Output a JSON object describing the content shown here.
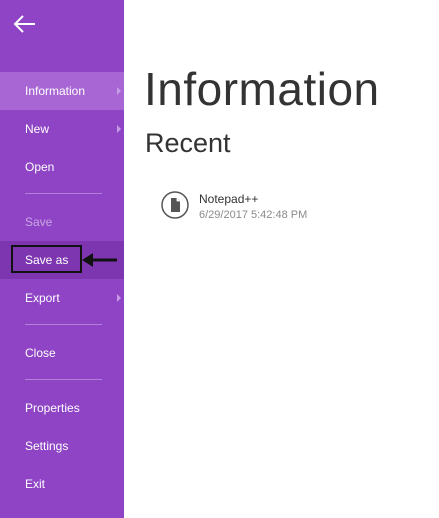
{
  "sidebar": {
    "back_icon": "back-arrow-icon",
    "items": [
      {
        "label": "Information",
        "state": "selected",
        "has_submenu": true
      },
      {
        "label": "New",
        "state": "normal",
        "has_submenu": true
      },
      {
        "label": "Open",
        "state": "normal",
        "has_submenu": false
      },
      {
        "label": "Save",
        "state": "disabled",
        "has_submenu": false
      },
      {
        "label": "Save as",
        "state": "hovered",
        "has_submenu": false
      },
      {
        "label": "Export",
        "state": "normal",
        "has_submenu": true
      },
      {
        "label": "Close",
        "state": "normal",
        "has_submenu": false
      },
      {
        "label": "Properties",
        "state": "normal",
        "has_submenu": false
      },
      {
        "label": "Settings",
        "state": "normal",
        "has_submenu": false
      },
      {
        "label": "Exit",
        "state": "normal",
        "has_submenu": false
      }
    ]
  },
  "main": {
    "title": "Information",
    "recent": {
      "heading": "Recent",
      "items": [
        {
          "name": "Notepad++",
          "date": "6/29/2017 5:42:48 PM",
          "icon": "document-icon"
        }
      ]
    }
  },
  "annotation": {
    "highlight_target": "Save as",
    "arrow_icon": "left-arrow-icon"
  },
  "colors": {
    "sidebar_bg": "#8e44c4",
    "selected_bg": "#a766d3",
    "hover_bg": "#7d36b0",
    "disabled_text": "#c9a6e3",
    "main_bg": "#ffffff",
    "title_text": "#333333",
    "secondary_text": "#8a8a8a"
  }
}
